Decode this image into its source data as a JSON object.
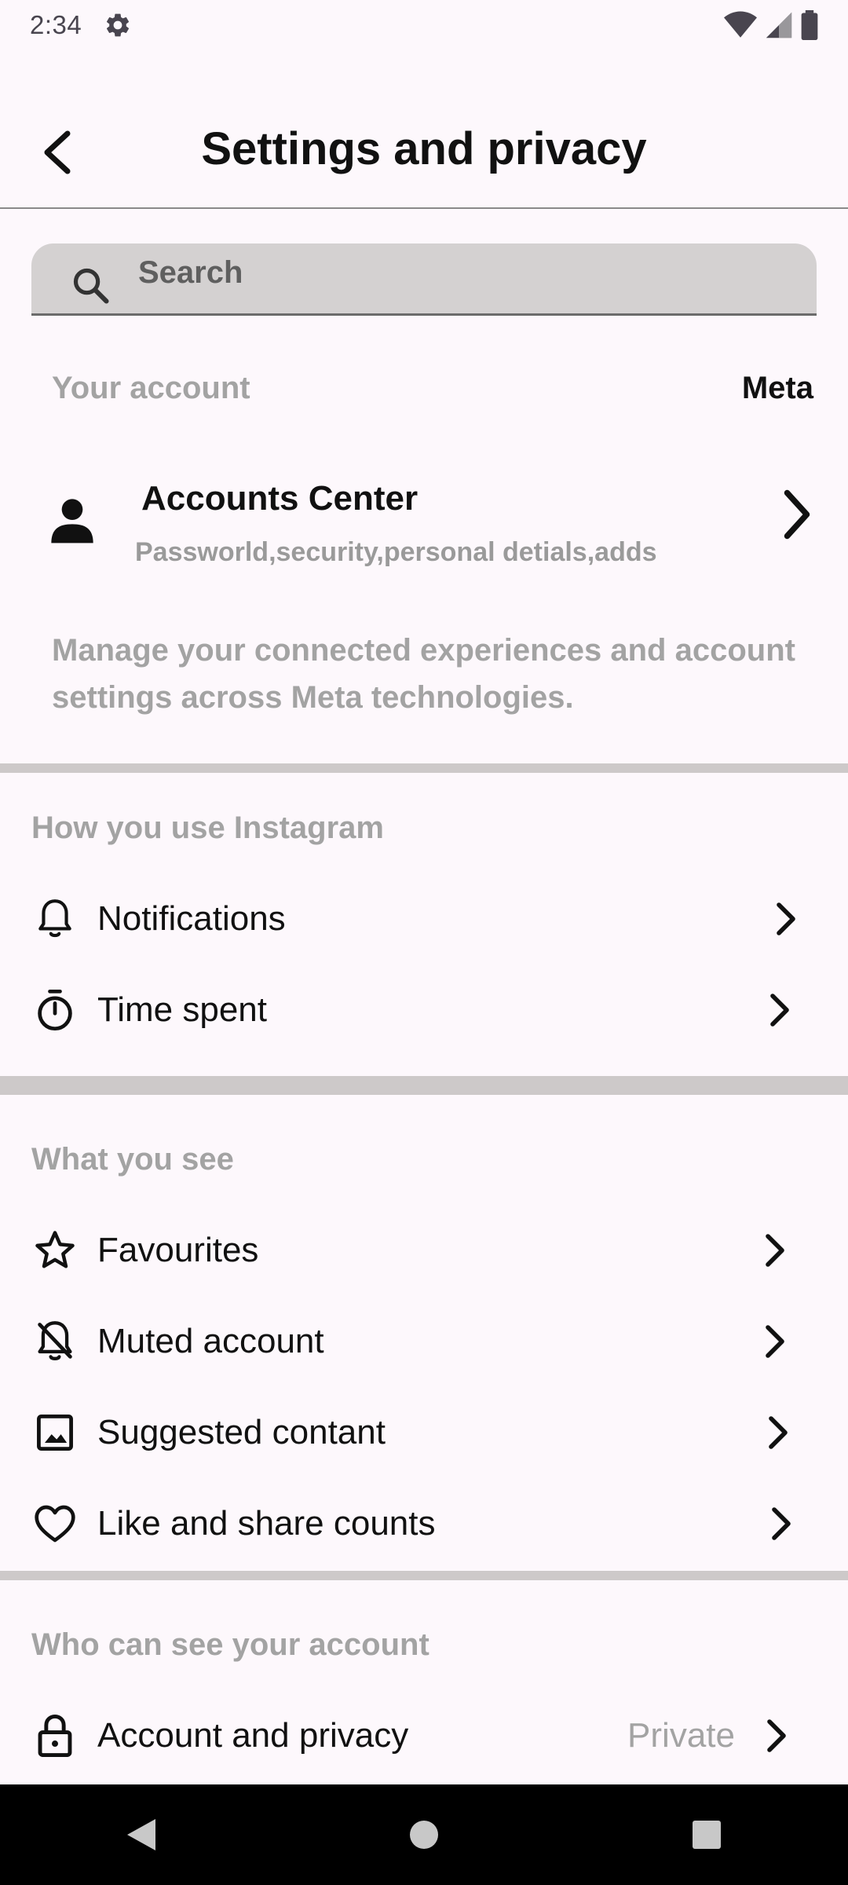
{
  "status_bar": {
    "time": "2:34"
  },
  "header": {
    "title": "Settings and privacy"
  },
  "search": {
    "placeholder": "Search"
  },
  "your_account": {
    "label": "Your account",
    "brand": "Meta",
    "accounts_center": {
      "title": "Accounts Center",
      "subtitle": "Passworld,security,personal detials,adds"
    },
    "description": "Manage your connected experiences and account settings across Meta technologies."
  },
  "sections": [
    {
      "title": "How you use Instagram",
      "items": [
        {
          "label": "Notifications",
          "icon": "bell-icon"
        },
        {
          "label": "Time spent",
          "icon": "timer-icon"
        }
      ]
    },
    {
      "title": "What you see",
      "items": [
        {
          "label": "Favourites",
          "icon": "star-icon"
        },
        {
          "label": "Muted account",
          "icon": "bell-off-icon"
        },
        {
          "label": "Suggested contant",
          "icon": "image-icon"
        },
        {
          "label": "Like and share counts",
          "icon": "heart-icon"
        }
      ]
    },
    {
      "title": "Who can see your account",
      "items": [
        {
          "label": "Account and privacy",
          "icon": "lock-icon",
          "value": "Private"
        }
      ]
    }
  ],
  "colors": {
    "background": "#fdf8fc",
    "muted_text": "#a3a3a3",
    "divider": "#cdc9c9",
    "search_fill": "#d4d1d1"
  }
}
